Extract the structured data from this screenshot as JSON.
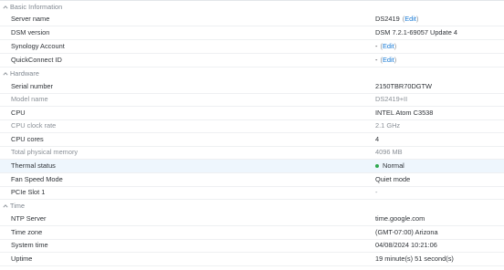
{
  "sections": {
    "basic": {
      "title": "Basic Information"
    },
    "hardware": {
      "title": "Hardware"
    },
    "time": {
      "title": "Time"
    }
  },
  "basic": {
    "server_name": {
      "label": "Server name",
      "value": "DS2419",
      "edit": "Edit"
    },
    "dsm_version": {
      "label": "DSM version",
      "value": "DSM 7.2.1-69057 Update 4"
    },
    "synology_account": {
      "label": "Synology Account",
      "value": "-",
      "edit": "Edit"
    },
    "quickconnect_id": {
      "label": "QuickConnect ID",
      "value": "-",
      "edit": "Edit"
    }
  },
  "hardware": {
    "serial_number": {
      "label": "Serial number",
      "value": "2150TBR70DGTW"
    },
    "model_name": {
      "label": "Model name",
      "value": "DS2419+II"
    },
    "cpu": {
      "label": "CPU",
      "value": "INTEL Atom C3538"
    },
    "cpu_clock": {
      "label": "CPU clock rate",
      "value": "2.1 GHz"
    },
    "cpu_cores": {
      "label": "CPU cores",
      "value": "4"
    },
    "memory": {
      "label": "Total physical memory",
      "value": "4096 MB"
    },
    "thermal": {
      "label": "Thermal status",
      "value": "Normal",
      "status_color": "#2fa84f"
    },
    "fan_mode": {
      "label": "Fan Speed Mode",
      "value": "Quiet mode"
    },
    "pcie_slot": {
      "label": "PCIe Slot 1",
      "value": "-"
    }
  },
  "time": {
    "ntp_server": {
      "label": "NTP Server",
      "value": "time.google.com"
    },
    "time_zone": {
      "label": "Time zone",
      "value": "(GMT-07:00) Arizona"
    },
    "system_time": {
      "label": "System time",
      "value": "04/08/2024 10:21:06"
    },
    "uptime": {
      "label": "Uptime",
      "value": "19 minute(s) 51 second(s)"
    }
  },
  "icons": {
    "section_toggle": "chevron-up-icon",
    "status": "status-dot-icon"
  },
  "colors": {
    "link": "#1a7bd6",
    "highlight_row": "#eef6fd",
    "section_text": "#7d858e"
  }
}
